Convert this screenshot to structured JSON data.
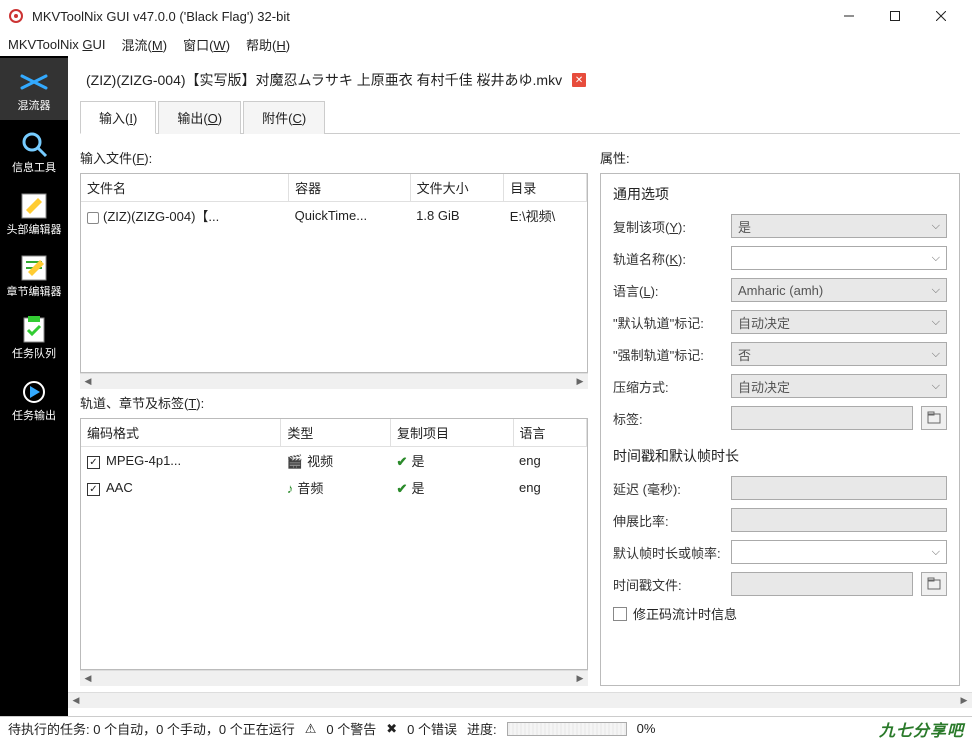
{
  "window": {
    "title": "MKVToolNix GUI v47.0.0 ('Black Flag') 32-bit"
  },
  "menu": {
    "app": "MKVToolNix GUI",
    "mux": "混流(M)",
    "window": "窗口(W)",
    "help": "帮助(H)"
  },
  "sidebar": {
    "items": [
      {
        "label": "混流器"
      },
      {
        "label": "信息工具"
      },
      {
        "label": "头部编辑器"
      },
      {
        "label": "章节编辑器"
      },
      {
        "label": "任务队列"
      },
      {
        "label": "任务输出"
      }
    ]
  },
  "file_tab": {
    "name": "(ZIZ)(ZIZG-004)【实写版】对魔忍ムラサキ 上原亜衣 有村千佳 桜井あゆ.mkv"
  },
  "subtabs": {
    "input": "输入(I)",
    "output": "输出(O)",
    "attach": "附件(C)"
  },
  "input_section": {
    "label": "输入文件(F):",
    "headers": {
      "name": "文件名",
      "container": "容器",
      "size": "文件大小",
      "dir": "目录"
    },
    "rows": [
      {
        "name": "(ZIZ)(ZIZG-004)【...",
        "container": "QuickTime...",
        "size": "1.8 GiB",
        "dir": "E:\\视频\\"
      }
    ]
  },
  "tracks_section": {
    "label": "轨道、章节及标签(T):",
    "headers": {
      "codec": "编码格式",
      "type": "类型",
      "copy": "复制项目",
      "lang": "语言"
    },
    "rows": [
      {
        "codec": "MPEG-4p1...",
        "type": "视频",
        "copy": "是",
        "lang": "eng",
        "type_icon": "🎬"
      },
      {
        "codec": "AAC",
        "type": "音频",
        "copy": "是",
        "lang": "eng",
        "type_icon": "♪"
      }
    ]
  },
  "properties": {
    "label": "属性:",
    "general_title": "通用选项",
    "copy_item": {
      "label": "复制该项(Y):",
      "value": "是"
    },
    "track_name": {
      "label": "轨道名称(K):",
      "value": ""
    },
    "language": {
      "label": "语言(L):",
      "value": "Amharic (amh)"
    },
    "default_flag": {
      "label": "\"默认轨道\"标记:",
      "value": "自动决定"
    },
    "forced_flag": {
      "label": "\"强制轨道\"标记:",
      "value": "否"
    },
    "compression": {
      "label": "压缩方式:",
      "value": "自动决定"
    },
    "tags": {
      "label": "标签:",
      "value": ""
    },
    "timing_title": "时间戳和默认帧时长",
    "delay": {
      "label": "延迟 (毫秒):",
      "value": ""
    },
    "stretch": {
      "label": "伸展比率:",
      "value": ""
    },
    "default_dur": {
      "label": "默认帧时长或帧率:",
      "value": ""
    },
    "timestamp_file": {
      "label": "时间戳文件:",
      "value": ""
    },
    "fix_timing": "修正码流计时信息"
  },
  "status": {
    "tasks": "待执行的任务: 0 个自动，0 个手动，0 个正在运行",
    "warnings": "0 个警告",
    "errors": "0 个错误",
    "progress_label": "进度:",
    "progress_pct": "0%",
    "brand": "九七分享吧"
  }
}
